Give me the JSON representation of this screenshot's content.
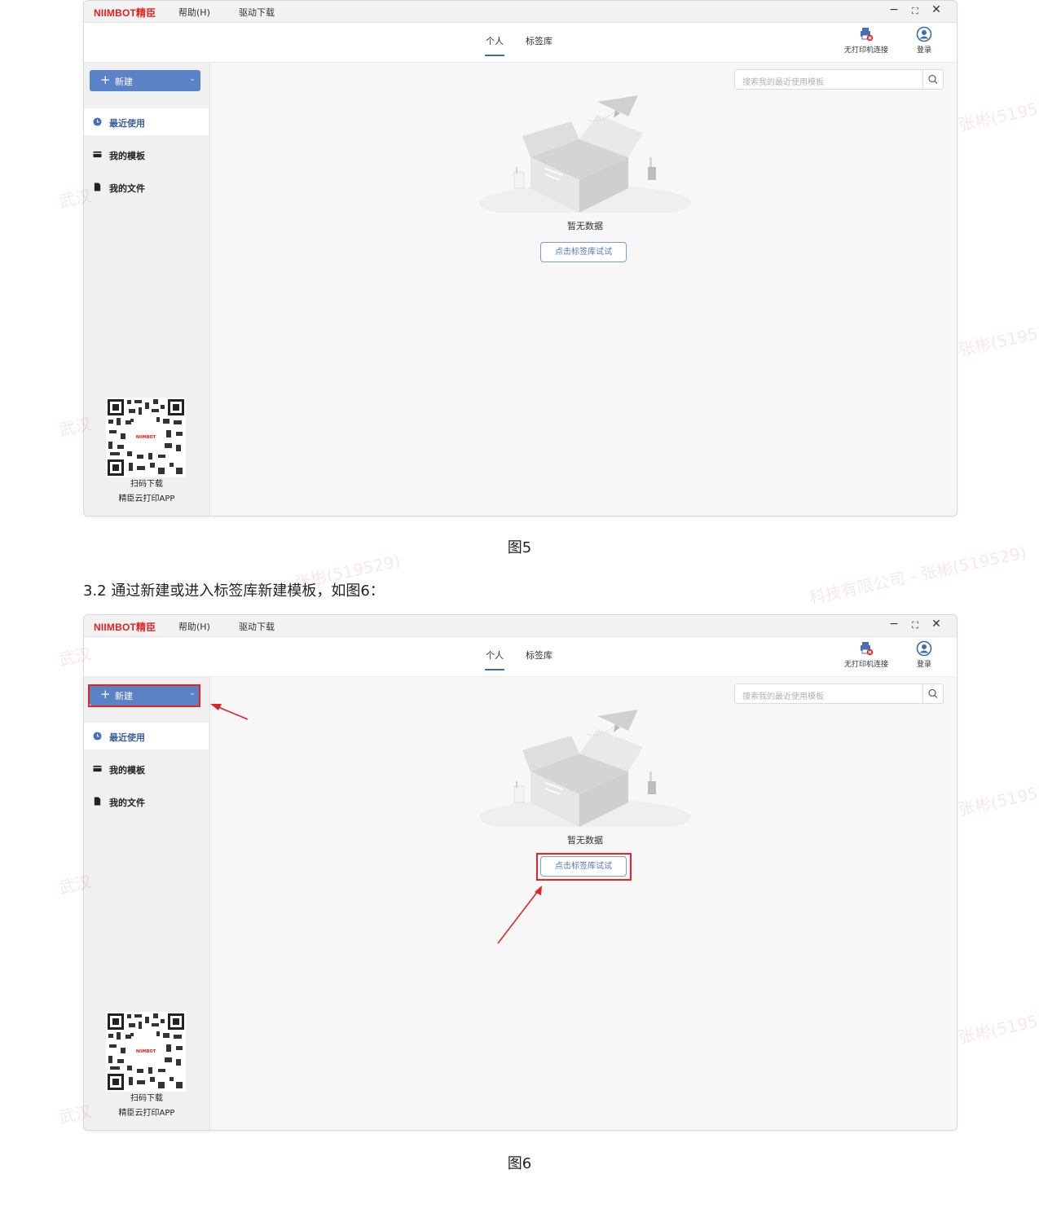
{
  "app": {
    "logo": "NIIMBOT精臣",
    "menu_help": "帮助(H)",
    "menu_driver": "驱动下载",
    "win_min": "−",
    "win_max": "⛶",
    "win_close": "✕",
    "tab_personal": "个人",
    "tab_library": "标签库",
    "printer_status": "无打印机连接",
    "login": "登录",
    "new_button": "新建",
    "nav_recent": "最近使用",
    "nav_templates": "我的模板",
    "nav_files": "我的文件",
    "qr_logo": "NIIMBOT",
    "qr_caption_1": "扫码下载",
    "qr_caption_2": "精臣云打印APP",
    "search_placeholder": "搜索我的最近使用模板",
    "empty_text": "暂无数据",
    "try_button": "点击标签库试试"
  },
  "document": {
    "figure5_caption": "图5",
    "section_title": "3.2 通过新建或进入标签库新建模板，如图6：",
    "figure6_caption": "图6"
  },
  "watermark": {
    "text": "张彬(519529)",
    "text2": "科技有限公司 - 张彬(519529)",
    "text3": "武汉"
  },
  "colors": {
    "brand_red": "#e0211f",
    "accent_blue": "#5b82c6",
    "highlight_red": "#e32424"
  }
}
